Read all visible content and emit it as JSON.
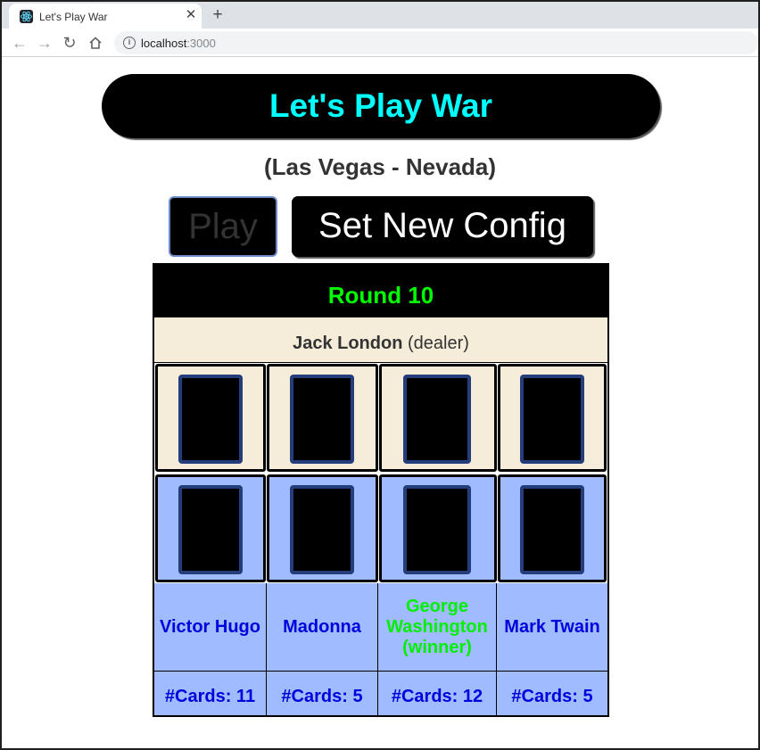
{
  "browser": {
    "tab_title": "Let's Play War",
    "url_host": "localhost",
    "url_port": ":3000"
  },
  "page": {
    "title": "Let's Play War",
    "location": "(Las Vegas - Nevada)",
    "play_label": "Play",
    "config_label": "Set New Config"
  },
  "game": {
    "round": "Round 10",
    "dealer_name": "Jack London",
    "dealer_suffix": " (dealer)",
    "players": [
      {
        "name": "Victor Hugo",
        "cards": "#Cards: 11",
        "winner": false
      },
      {
        "name": "Madonna",
        "cards": "#Cards: 5",
        "winner": false
      },
      {
        "name": "George Washington (winner)",
        "cards": "#Cards: 12",
        "winner": true
      },
      {
        "name": "Mark Twain",
        "cards": "#Cards: 5",
        "winner": false
      }
    ]
  },
  "colors": {
    "title": "#00ffff",
    "round": "#00ff00",
    "player_text": "#0000dd",
    "winner_text": "#00ee00",
    "dealer_bg": "#f5ecd9",
    "player_bg": "#a0bbff"
  }
}
